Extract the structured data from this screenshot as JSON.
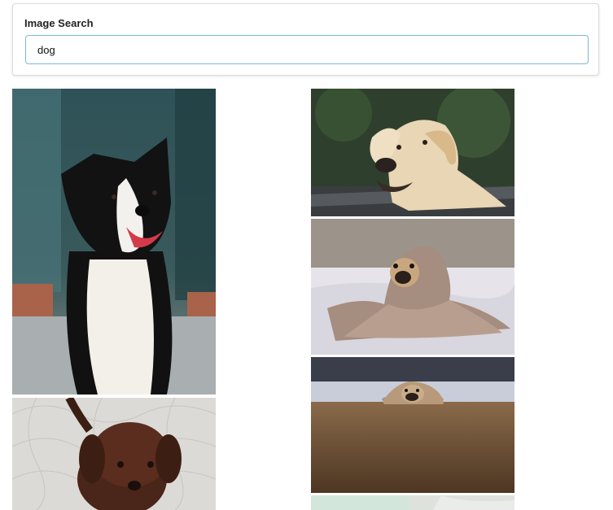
{
  "search": {
    "label": "Image Search",
    "value": "dog"
  },
  "results": {
    "images": [
      {
        "subject": "border-collie"
      },
      {
        "subject": "brown-puppy"
      },
      {
        "subject": "labrador"
      },
      {
        "subject": "pug-in-blanket"
      },
      {
        "subject": "pug-on-floor"
      },
      {
        "subject": "partial-image"
      }
    ]
  }
}
